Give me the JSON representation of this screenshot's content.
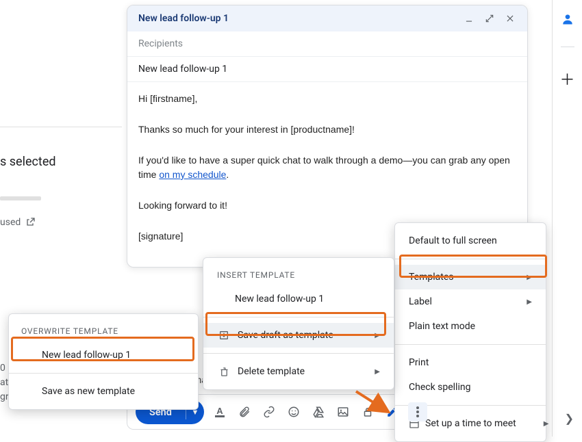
{
  "rightRail": {
    "avatar_fill": "#1a73e8"
  },
  "bg": {
    "selected_suffix": "s selected",
    "used_text": "used",
    "partial_tail": "0",
    "partial_tail2": "ati",
    "partial_tail3": "gr"
  },
  "compose": {
    "title": "New lead follow-up 1",
    "recipients_placeholder": "Recipients",
    "subject": "New lead follow-up 1",
    "body": {
      "greeting": "Hi [firstname],",
      "thanks": "Thanks so much for your interest in [productname]!",
      "pitch_pre": "If you'd like to have a super quick chat to walk through a demo—you can grab any open time ",
      "pitch_link": "on my schedule",
      "pitch_post": ".",
      "closing": "Looking forward to it!",
      "signature": "[signature]"
    }
  },
  "formatBar": {
    "font": "homa"
  },
  "sendBar": {
    "send_label": "Send"
  },
  "menuMain": {
    "default_full": "Default to full screen",
    "templates": "Templates",
    "label": "Label",
    "plain": "Plain text mode",
    "print": "Print",
    "spell": "Check spelling",
    "meet": "Set up a time to meet"
  },
  "menuInsert": {
    "header": "INSERT TEMPLATE",
    "item1": "New lead follow-up 1",
    "save": "Save draft as template",
    "delete": "Delete template"
  },
  "menuOverwrite": {
    "header": "OVERWRITE TEMPLATE",
    "item1": "New lead follow-up 1",
    "save_new": "Save as new template"
  }
}
